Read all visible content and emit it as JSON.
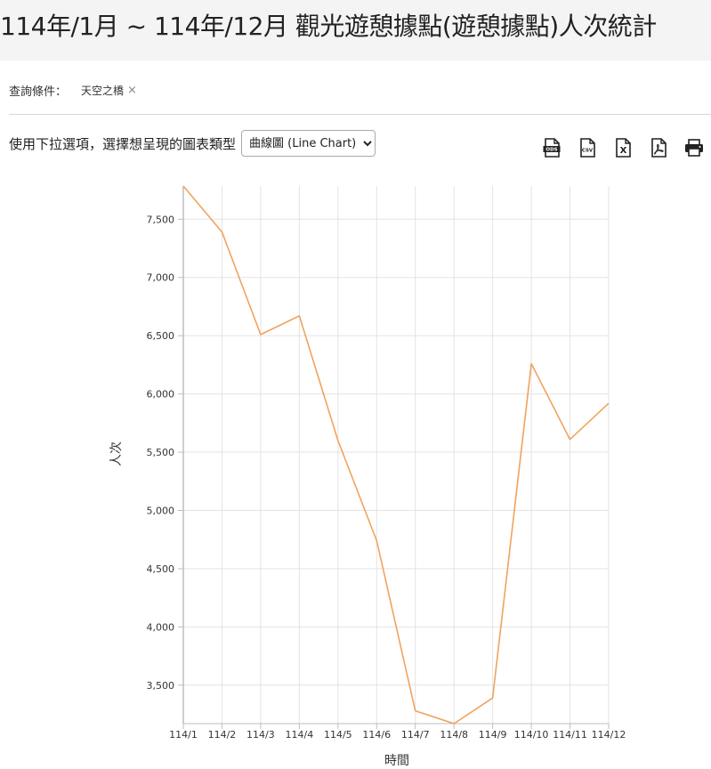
{
  "page": {
    "title": "114年/1月 ~ 114年/12月 觀光遊憩據點(遊憩據點)人次統計"
  },
  "filter": {
    "label": "查詢條件：",
    "tag": "天空之橋",
    "tag_close": "×"
  },
  "chart_type_selector": {
    "prompt": "使用下拉選項，選擇想呈現的圖表類型",
    "selected": "曲線圖 (Line Chart)"
  },
  "export_toolbar": {
    "icons": [
      "ods-file-icon",
      "csv-file-icon",
      "excel-file-icon",
      "pdf-file-icon",
      "print-icon"
    ],
    "ods_label": "ODS",
    "csv_label": "CSV",
    "xls_label": "X"
  },
  "colors": {
    "line": "#f0a35e",
    "grid": "#e3e3e3",
    "axis": "#bdbdbd"
  },
  "chart_data": {
    "type": "line",
    "categories": [
      "114/1",
      "114/2",
      "114/3",
      "114/4",
      "114/5",
      "114/6",
      "114/7",
      "114/8",
      "114/9",
      "114/10",
      "114/11",
      "114/12"
    ],
    "series": [
      {
        "values": [
          7785,
          7390,
          6510,
          6670,
          5600,
          4740,
          3280,
          3170,
          3390,
          6260,
          5610,
          5920
        ]
      }
    ],
    "yticks": [
      3500,
      4000,
      4500,
      5000,
      5500,
      6000,
      6500,
      7000,
      7500
    ],
    "ytick_labels": [
      "3,500",
      "4,000",
      "4,500",
      "5,000",
      "5,500",
      "6,000",
      "6,500",
      "7,000",
      "7,500"
    ],
    "ylim": [
      3170,
      7785
    ],
    "xlabel": "時間",
    "ylabel": "人次",
    "grid": true,
    "legend": "none"
  }
}
